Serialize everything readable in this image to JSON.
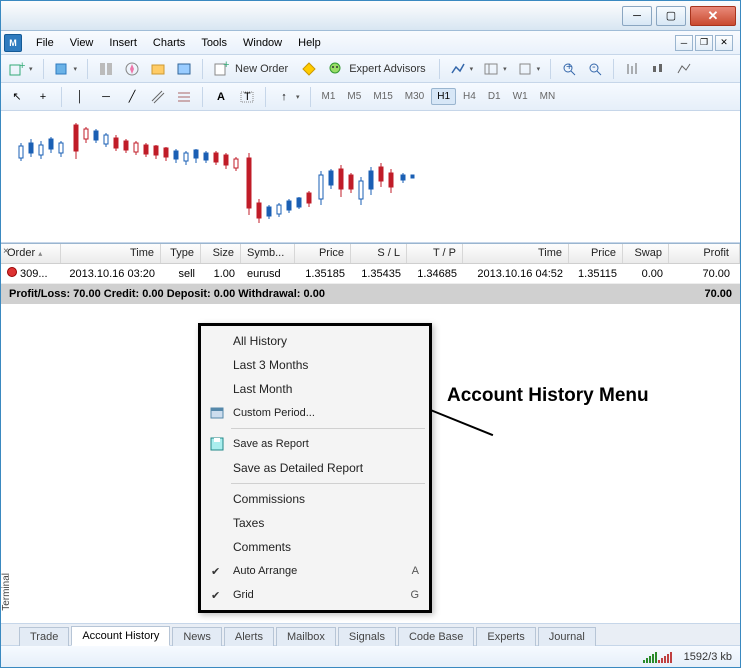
{
  "menubar": {
    "items": [
      "File",
      "View",
      "Insert",
      "Charts",
      "Tools",
      "Window",
      "Help"
    ]
  },
  "toolbar1": {
    "new_order": "New Order",
    "expert_advisors": "Expert Advisors"
  },
  "timeframes": [
    "M1",
    "M5",
    "M15",
    "M30",
    "H1",
    "H4",
    "D1",
    "W1",
    "MN"
  ],
  "active_timeframe": "H1",
  "grid": {
    "headers": [
      "Order",
      "Time",
      "Type",
      "Size",
      "Symb...",
      "Price",
      "S / L",
      "T / P",
      "Time",
      "Price",
      "Swap",
      "Profit"
    ],
    "row": {
      "order": "309...",
      "time": "2013.10.16 03:20",
      "type": "sell",
      "size": "1.00",
      "symbol": "eurusd",
      "price": "1.35185",
      "sl": "1.35435",
      "tp": "1.34685",
      "time2": "2013.10.16 04:52",
      "price2": "1.35115",
      "swap": "0.00",
      "profit": "70.00"
    },
    "summary": "Profit/Loss: 70.00  Credit: 0.00  Deposit: 0.00  Withdrawal: 0.00",
    "summary_right": "70.00"
  },
  "terminal_tabs": [
    "Trade",
    "Account History",
    "News",
    "Alerts",
    "Mailbox",
    "Signals",
    "Code Base",
    "Experts",
    "Journal"
  ],
  "active_tab": "Account History",
  "terminal_label": "Terminal",
  "context_menu": {
    "all_history": "All History",
    "last_3_months": "Last 3 Months",
    "last_month": "Last Month",
    "custom_period": "Custom Period...",
    "save_report": "Save as Report",
    "save_detailed": "Save as Detailed Report",
    "commissions": "Commissions",
    "taxes": "Taxes",
    "comments": "Comments",
    "auto_arrange": "Auto Arrange",
    "auto_arrange_short": "A",
    "grid": "Grid",
    "grid_short": "G"
  },
  "annotation": "Account History Menu",
  "status": {
    "traffic": "1592/3 kb"
  }
}
